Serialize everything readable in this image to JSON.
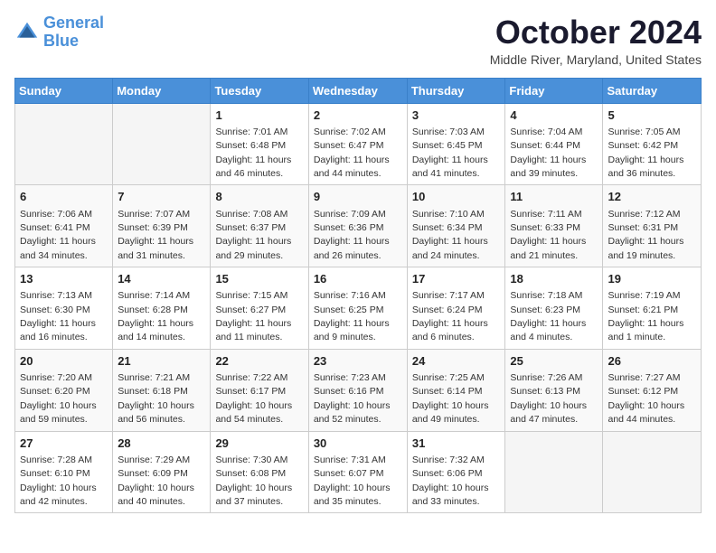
{
  "header": {
    "logo_line1": "General",
    "logo_line2": "Blue",
    "month_title": "October 2024",
    "location": "Middle River, Maryland, United States"
  },
  "weekdays": [
    "Sunday",
    "Monday",
    "Tuesday",
    "Wednesday",
    "Thursday",
    "Friday",
    "Saturday"
  ],
  "weeks": [
    [
      {
        "day": "",
        "empty": true
      },
      {
        "day": "",
        "empty": true
      },
      {
        "day": "1",
        "sunrise": "Sunrise: 7:01 AM",
        "sunset": "Sunset: 6:48 PM",
        "daylight": "Daylight: 11 hours and 46 minutes."
      },
      {
        "day": "2",
        "sunrise": "Sunrise: 7:02 AM",
        "sunset": "Sunset: 6:47 PM",
        "daylight": "Daylight: 11 hours and 44 minutes."
      },
      {
        "day": "3",
        "sunrise": "Sunrise: 7:03 AM",
        "sunset": "Sunset: 6:45 PM",
        "daylight": "Daylight: 11 hours and 41 minutes."
      },
      {
        "day": "4",
        "sunrise": "Sunrise: 7:04 AM",
        "sunset": "Sunset: 6:44 PM",
        "daylight": "Daylight: 11 hours and 39 minutes."
      },
      {
        "day": "5",
        "sunrise": "Sunrise: 7:05 AM",
        "sunset": "Sunset: 6:42 PM",
        "daylight": "Daylight: 11 hours and 36 minutes."
      }
    ],
    [
      {
        "day": "6",
        "sunrise": "Sunrise: 7:06 AM",
        "sunset": "Sunset: 6:41 PM",
        "daylight": "Daylight: 11 hours and 34 minutes."
      },
      {
        "day": "7",
        "sunrise": "Sunrise: 7:07 AM",
        "sunset": "Sunset: 6:39 PM",
        "daylight": "Daylight: 11 hours and 31 minutes."
      },
      {
        "day": "8",
        "sunrise": "Sunrise: 7:08 AM",
        "sunset": "Sunset: 6:37 PM",
        "daylight": "Daylight: 11 hours and 29 minutes."
      },
      {
        "day": "9",
        "sunrise": "Sunrise: 7:09 AM",
        "sunset": "Sunset: 6:36 PM",
        "daylight": "Daylight: 11 hours and 26 minutes."
      },
      {
        "day": "10",
        "sunrise": "Sunrise: 7:10 AM",
        "sunset": "Sunset: 6:34 PM",
        "daylight": "Daylight: 11 hours and 24 minutes."
      },
      {
        "day": "11",
        "sunrise": "Sunrise: 7:11 AM",
        "sunset": "Sunset: 6:33 PM",
        "daylight": "Daylight: 11 hours and 21 minutes."
      },
      {
        "day": "12",
        "sunrise": "Sunrise: 7:12 AM",
        "sunset": "Sunset: 6:31 PM",
        "daylight": "Daylight: 11 hours and 19 minutes."
      }
    ],
    [
      {
        "day": "13",
        "sunrise": "Sunrise: 7:13 AM",
        "sunset": "Sunset: 6:30 PM",
        "daylight": "Daylight: 11 hours and 16 minutes."
      },
      {
        "day": "14",
        "sunrise": "Sunrise: 7:14 AM",
        "sunset": "Sunset: 6:28 PM",
        "daylight": "Daylight: 11 hours and 14 minutes."
      },
      {
        "day": "15",
        "sunrise": "Sunrise: 7:15 AM",
        "sunset": "Sunset: 6:27 PM",
        "daylight": "Daylight: 11 hours and 11 minutes."
      },
      {
        "day": "16",
        "sunrise": "Sunrise: 7:16 AM",
        "sunset": "Sunset: 6:25 PM",
        "daylight": "Daylight: 11 hours and 9 minutes."
      },
      {
        "day": "17",
        "sunrise": "Sunrise: 7:17 AM",
        "sunset": "Sunset: 6:24 PM",
        "daylight": "Daylight: 11 hours and 6 minutes."
      },
      {
        "day": "18",
        "sunrise": "Sunrise: 7:18 AM",
        "sunset": "Sunset: 6:23 PM",
        "daylight": "Daylight: 11 hours and 4 minutes."
      },
      {
        "day": "19",
        "sunrise": "Sunrise: 7:19 AM",
        "sunset": "Sunset: 6:21 PM",
        "daylight": "Daylight: 11 hours and 1 minute."
      }
    ],
    [
      {
        "day": "20",
        "sunrise": "Sunrise: 7:20 AM",
        "sunset": "Sunset: 6:20 PM",
        "daylight": "Daylight: 10 hours and 59 minutes."
      },
      {
        "day": "21",
        "sunrise": "Sunrise: 7:21 AM",
        "sunset": "Sunset: 6:18 PM",
        "daylight": "Daylight: 10 hours and 56 minutes."
      },
      {
        "day": "22",
        "sunrise": "Sunrise: 7:22 AM",
        "sunset": "Sunset: 6:17 PM",
        "daylight": "Daylight: 10 hours and 54 minutes."
      },
      {
        "day": "23",
        "sunrise": "Sunrise: 7:23 AM",
        "sunset": "Sunset: 6:16 PM",
        "daylight": "Daylight: 10 hours and 52 minutes."
      },
      {
        "day": "24",
        "sunrise": "Sunrise: 7:25 AM",
        "sunset": "Sunset: 6:14 PM",
        "daylight": "Daylight: 10 hours and 49 minutes."
      },
      {
        "day": "25",
        "sunrise": "Sunrise: 7:26 AM",
        "sunset": "Sunset: 6:13 PM",
        "daylight": "Daylight: 10 hours and 47 minutes."
      },
      {
        "day": "26",
        "sunrise": "Sunrise: 7:27 AM",
        "sunset": "Sunset: 6:12 PM",
        "daylight": "Daylight: 10 hours and 44 minutes."
      }
    ],
    [
      {
        "day": "27",
        "sunrise": "Sunrise: 7:28 AM",
        "sunset": "Sunset: 6:10 PM",
        "daylight": "Daylight: 10 hours and 42 minutes."
      },
      {
        "day": "28",
        "sunrise": "Sunrise: 7:29 AM",
        "sunset": "Sunset: 6:09 PM",
        "daylight": "Daylight: 10 hours and 40 minutes."
      },
      {
        "day": "29",
        "sunrise": "Sunrise: 7:30 AM",
        "sunset": "Sunset: 6:08 PM",
        "daylight": "Daylight: 10 hours and 37 minutes."
      },
      {
        "day": "30",
        "sunrise": "Sunrise: 7:31 AM",
        "sunset": "Sunset: 6:07 PM",
        "daylight": "Daylight: 10 hours and 35 minutes."
      },
      {
        "day": "31",
        "sunrise": "Sunrise: 7:32 AM",
        "sunset": "Sunset: 6:06 PM",
        "daylight": "Daylight: 10 hours and 33 minutes."
      },
      {
        "day": "",
        "empty": true
      },
      {
        "day": "",
        "empty": true
      }
    ]
  ]
}
